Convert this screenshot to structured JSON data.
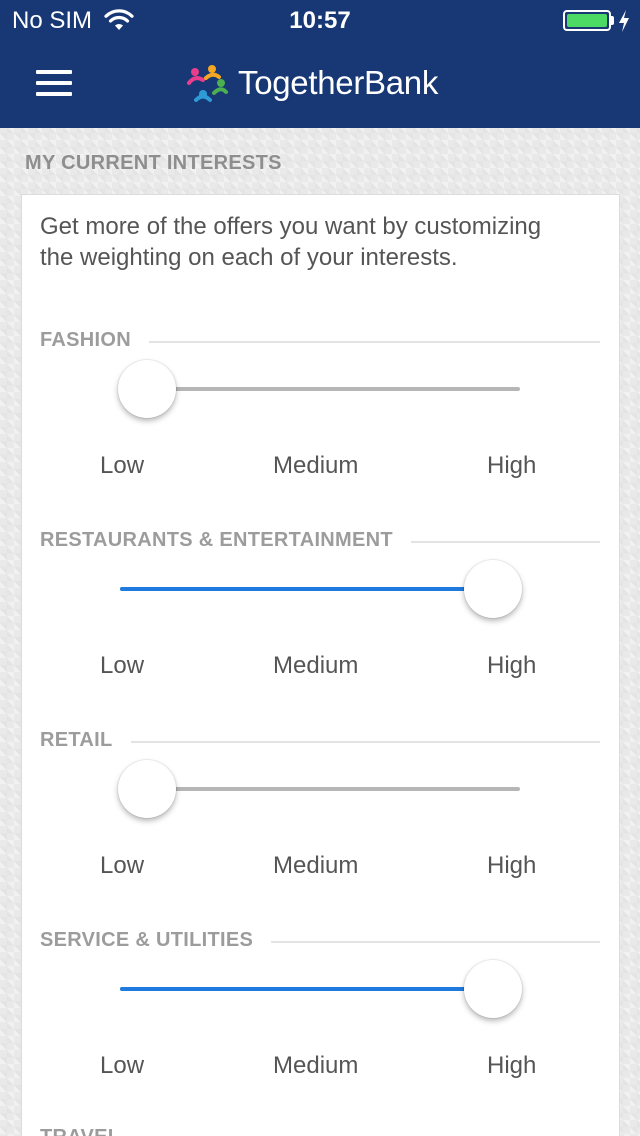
{
  "status_bar": {
    "carrier": "No SIM",
    "time": "10:57",
    "wifi_icon": "wifi-icon",
    "battery_icon": "battery-icon",
    "battery_level": 1.0,
    "charging_icon": "bolt-icon"
  },
  "header": {
    "menu_icon": "hamburger-menu-icon",
    "logo_icon": "togetherbank-logo-icon",
    "brand": "TogetherBank",
    "background_color": "#173874"
  },
  "page": {
    "section_title": "MY CURRENT INTERESTS",
    "intro": "Get more of the offers you want by customizing the weighting on each of your interests."
  },
  "slider_labels": {
    "low": "Low",
    "medium": "Medium",
    "high": "High"
  },
  "accent_color": "#1f7ae0",
  "interests": [
    {
      "label": "FASHION",
      "value": 0
    },
    {
      "label": "RESTAURANTS & ENTERTAINMENT",
      "value": 1
    },
    {
      "label": "RETAIL",
      "value": 0
    },
    {
      "label": "SERVICE & UTILITIES",
      "value": 1
    }
  ],
  "next_interest_partial": "TRAVEL"
}
